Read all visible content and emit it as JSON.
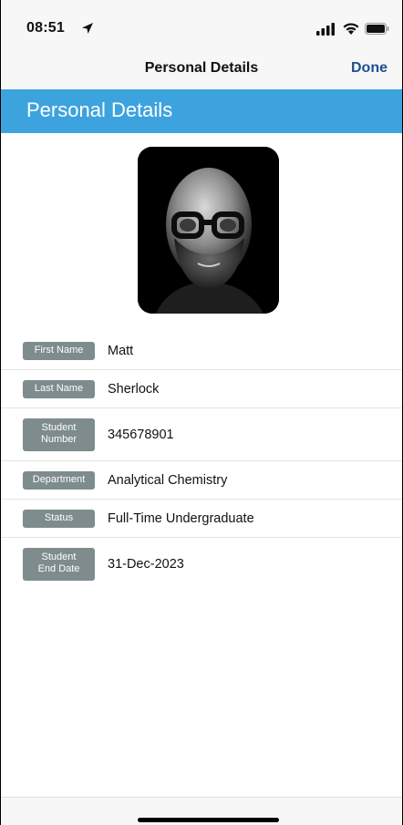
{
  "status_bar": {
    "time": "08:51",
    "icons": [
      "location-arrow-icon",
      "cellular-signal-icon",
      "wifi-icon",
      "battery-icon"
    ]
  },
  "nav": {
    "title": "Personal Details",
    "done_label": "Done",
    "done_color": "#1f4f8f"
  },
  "section": {
    "title": "Personal Details",
    "color": "#3da3df"
  },
  "details": {
    "badge_color": "#7e8c8d",
    "rows": [
      {
        "label": "First Name",
        "value": "Matt"
      },
      {
        "label": "Last Name",
        "value": "Sherlock"
      },
      {
        "label": "Student\nNumber",
        "value": "345678901"
      },
      {
        "label": "Department",
        "value": "Analytical Chemistry"
      },
      {
        "label": "Status",
        "value": "Full-Time Undergraduate"
      },
      {
        "label": "Student\nEnd Date",
        "value": "31-Dec-2023"
      }
    ]
  }
}
